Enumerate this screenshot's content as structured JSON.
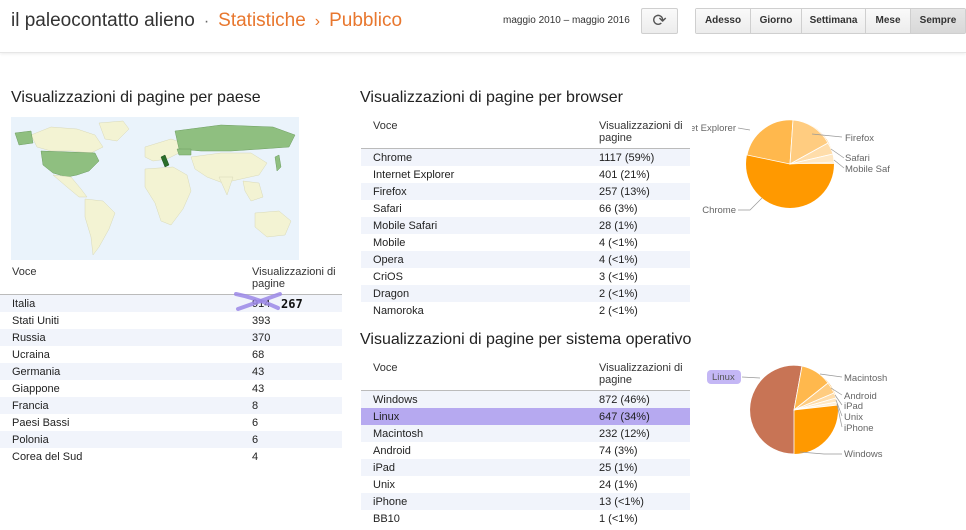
{
  "header": {
    "site": "il paleocontatto alieno",
    "sep1": "·",
    "section": "Statistiche",
    "sep2": "›",
    "subsection": "Pubblico",
    "date_range": "maggio 2010 – maggio 2016",
    "refresh_icon": "⟳",
    "periods": [
      "Adesso",
      "Giorno",
      "Settimana",
      "Mese",
      "Sempre"
    ],
    "active_period": "Sempre"
  },
  "country": {
    "title": "Visualizzazioni di pagine per paese",
    "col_item": "Voce",
    "col_views": "Visualizzazioni di pagine",
    "rows": [
      {
        "name": "Italia",
        "value": "914"
      },
      {
        "name": "Stati Uniti",
        "value": "393"
      },
      {
        "name": "Russia",
        "value": "370"
      },
      {
        "name": "Ucraina",
        "value": "68"
      },
      {
        "name": "Germania",
        "value": "43"
      },
      {
        "name": "Giappone",
        "value": "43"
      },
      {
        "name": "Francia",
        "value": "8"
      },
      {
        "name": "Paesi Bassi",
        "value": "6"
      },
      {
        "name": "Polonia",
        "value": "6"
      },
      {
        "name": "Corea del Sud",
        "value": "4"
      }
    ],
    "handwritten_note": "267"
  },
  "browser": {
    "title": "Visualizzazioni di pagine per browser",
    "col_item": "Voce",
    "col_views": "Visualizzazioni di pagine",
    "rows": [
      {
        "name": "Chrome",
        "value": "1117 (59%)"
      },
      {
        "name": "Internet Explorer",
        "value": "401 (21%)"
      },
      {
        "name": "Firefox",
        "value": "257 (13%)"
      },
      {
        "name": "Safari",
        "value": "66 (3%)"
      },
      {
        "name": "Mobile Safari",
        "value": "28 (1%)"
      },
      {
        "name": "Mobile",
        "value": "4 (<1%)"
      },
      {
        "name": "Opera",
        "value": "4 (<1%)"
      },
      {
        "name": "CriOS",
        "value": "3 (<1%)"
      },
      {
        "name": "Dragon",
        "value": "2 (<1%)"
      },
      {
        "name": "Namoroka",
        "value": "2 (<1%)"
      }
    ],
    "pie_labels": {
      "ie": "Internet Explorer",
      "firefox": "Firefox",
      "safari": "Safari",
      "mobile_safari": "Mobile Safari",
      "chrome": "Chrome"
    }
  },
  "os": {
    "title": "Visualizzazioni di pagine per sistema operativo",
    "col_item": "Voce",
    "col_views": "Visualizzazioni di pagine",
    "highlighted": "Linux",
    "rows": [
      {
        "name": "Windows",
        "value": "872 (46%)"
      },
      {
        "name": "Linux",
        "value": "647 (34%)"
      },
      {
        "name": "Macintosh",
        "value": "232 (12%)"
      },
      {
        "name": "Android",
        "value": "74 (3%)"
      },
      {
        "name": "iPad",
        "value": "25 (1%)"
      },
      {
        "name": "Unix",
        "value": "24 (1%)"
      },
      {
        "name": "iPhone",
        "value": "13 (<1%)"
      },
      {
        "name": "BB10",
        "value": "1 (<1%)"
      }
    ],
    "pie_labels": {
      "linux": "Linux",
      "macintosh": "Macintosh",
      "android": "Android",
      "ipad": "iPad",
      "unix": "Unix",
      "iphone": "iPhone",
      "windows": "Windows"
    }
  },
  "colors": {
    "accent": "#e8772e",
    "pie_main": "#ff9900",
    "pie_linux": "#c87455",
    "highlight": "#b6a9f0",
    "map_land": "#f3f3d3",
    "map_hit": "#8fbf80",
    "map_water": "#eaf3fb"
  }
}
